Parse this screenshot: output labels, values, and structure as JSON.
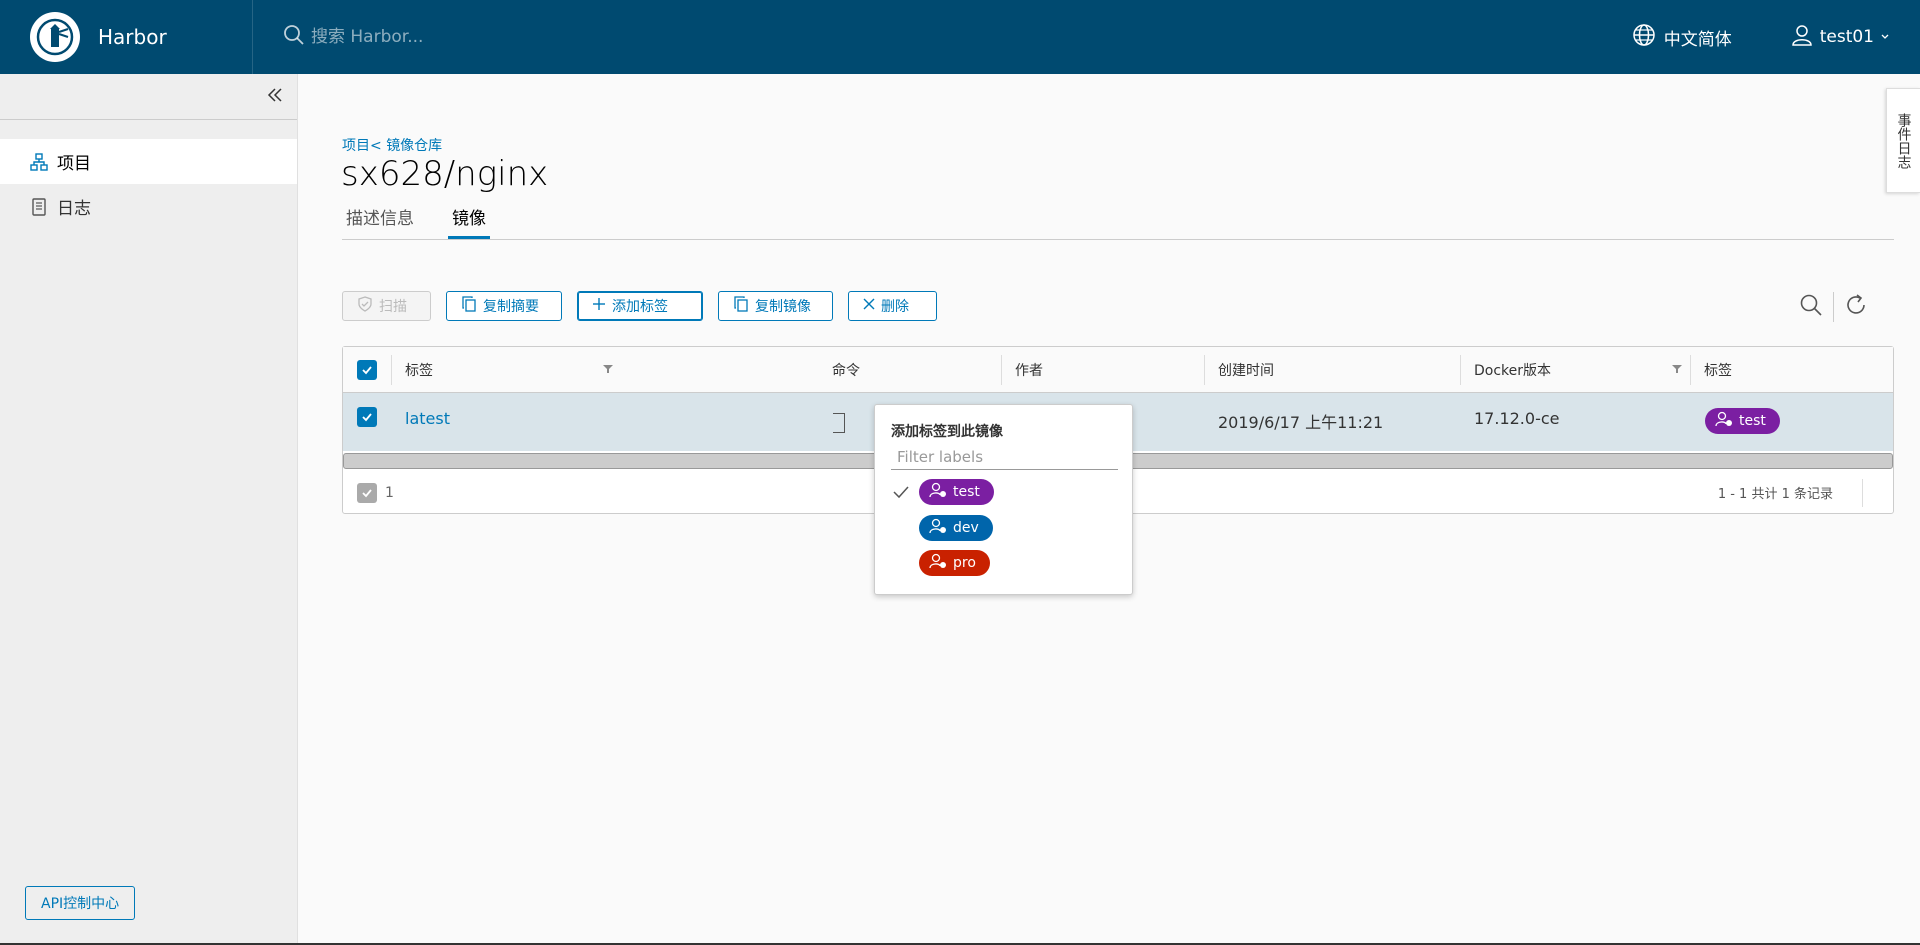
{
  "header": {
    "brand": "Harbor",
    "search_placeholder": "搜索 Harbor...",
    "language": "中文简体",
    "user": "test01"
  },
  "sidebar": {
    "items": [
      {
        "label": "项目",
        "icon": "project-icon",
        "active": true
      },
      {
        "label": "日志",
        "icon": "log-icon",
        "active": false
      }
    ],
    "api_button": "API控制中心"
  },
  "main": {
    "breadcrumb": {
      "project": "项目",
      "separator": "<",
      "repo": "镜像仓库"
    },
    "title": "sx628/nginx",
    "tabs": [
      {
        "label": "描述信息",
        "active": false
      },
      {
        "label": "镜像",
        "active": true
      }
    ],
    "toolbar": {
      "scan": "扫描",
      "copy_digest": "复制摘要",
      "add_label": "添加标签",
      "copy_image": "复制镜像",
      "delete": "删除"
    },
    "table": {
      "columns": [
        "标签",
        "命令",
        "作者",
        "创建时间",
        "Docker版本",
        "标签"
      ],
      "rows": [
        {
          "tag": "latest",
          "author": "",
          "created": "2019/6/17 上午11:21",
          "docker_version": "17.12.0-ce",
          "label": "test"
        }
      ],
      "footer_selected": "1",
      "pagination": "1 - 1 共计 1 条记录"
    }
  },
  "label_dropdown": {
    "title": "添加标签到此镜像",
    "filter_placeholder": "Filter labels",
    "labels": [
      {
        "name": "test",
        "color": "#7b1fa2",
        "checked": true
      },
      {
        "name": "dev",
        "color": "#0065ab",
        "checked": false
      },
      {
        "name": "pro",
        "color": "#c92100",
        "checked": false
      }
    ]
  },
  "side_tab": "事件日志",
  "colors": {
    "header": "#004a70",
    "accent": "#0079b8",
    "label_test": "#7b1fa2",
    "label_dev": "#0065ab",
    "label_pro": "#c92100"
  }
}
